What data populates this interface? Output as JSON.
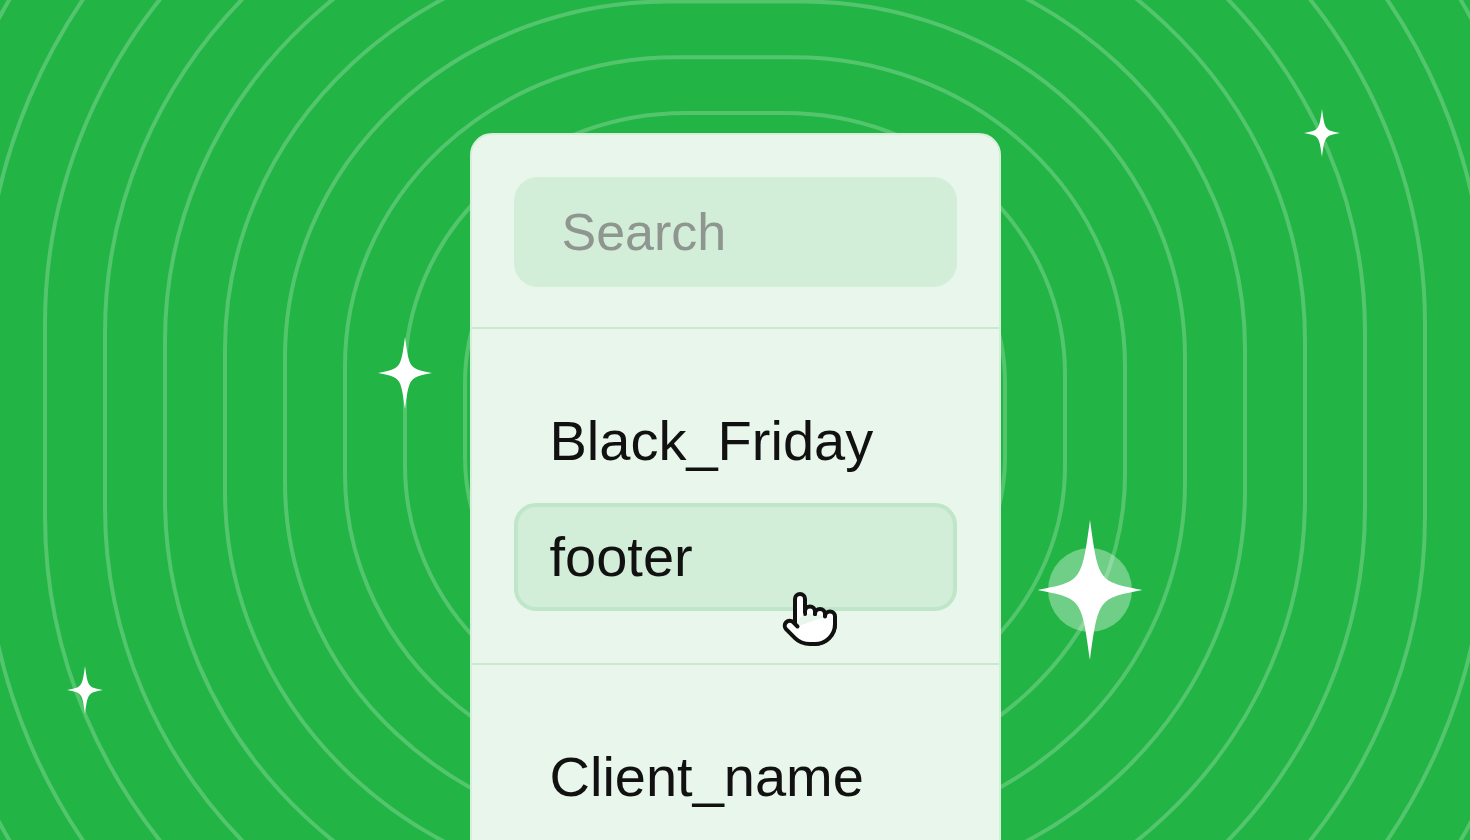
{
  "search": {
    "placeholder": "Search"
  },
  "groups": [
    {
      "items": [
        {
          "label": "Black_Friday",
          "selected": false
        },
        {
          "label": "footer",
          "selected": true
        }
      ]
    },
    {
      "items": [
        {
          "label": "Client_name",
          "selected": false
        }
      ]
    }
  ]
}
